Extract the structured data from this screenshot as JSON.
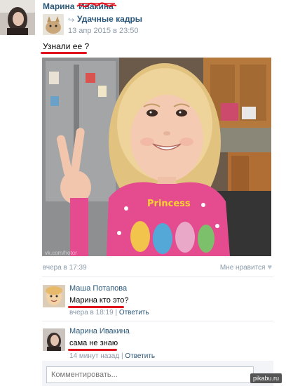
{
  "post": {
    "author_name": "Марина",
    "author_surname_scribbled": "Ивакина",
    "group_name": "Удачные кадры",
    "date": "13 апр 2015 в 23:50",
    "text": "Узнали ее ?",
    "photo_watermark": "vk.com/hotor",
    "time": "вчера в 17:39",
    "like_label": "Мне нравится"
  },
  "comments": [
    {
      "name": "Маша Потапова",
      "text": "Марина кто это?",
      "time": "вчера в 18:19",
      "separator": "|",
      "reply_label": "Ответить"
    },
    {
      "name": "Марина Ивакина",
      "text": "сама не знаю",
      "time": "14 минут назад",
      "separator": "|",
      "reply_label": "Ответить"
    }
  ],
  "comment_input": {
    "placeholder": "Комментировать..."
  },
  "watermark": "pikabu.ru",
  "colors": {
    "link": "#2b587a",
    "meta": "#8a9aa9",
    "highlight": "#e0121b"
  }
}
